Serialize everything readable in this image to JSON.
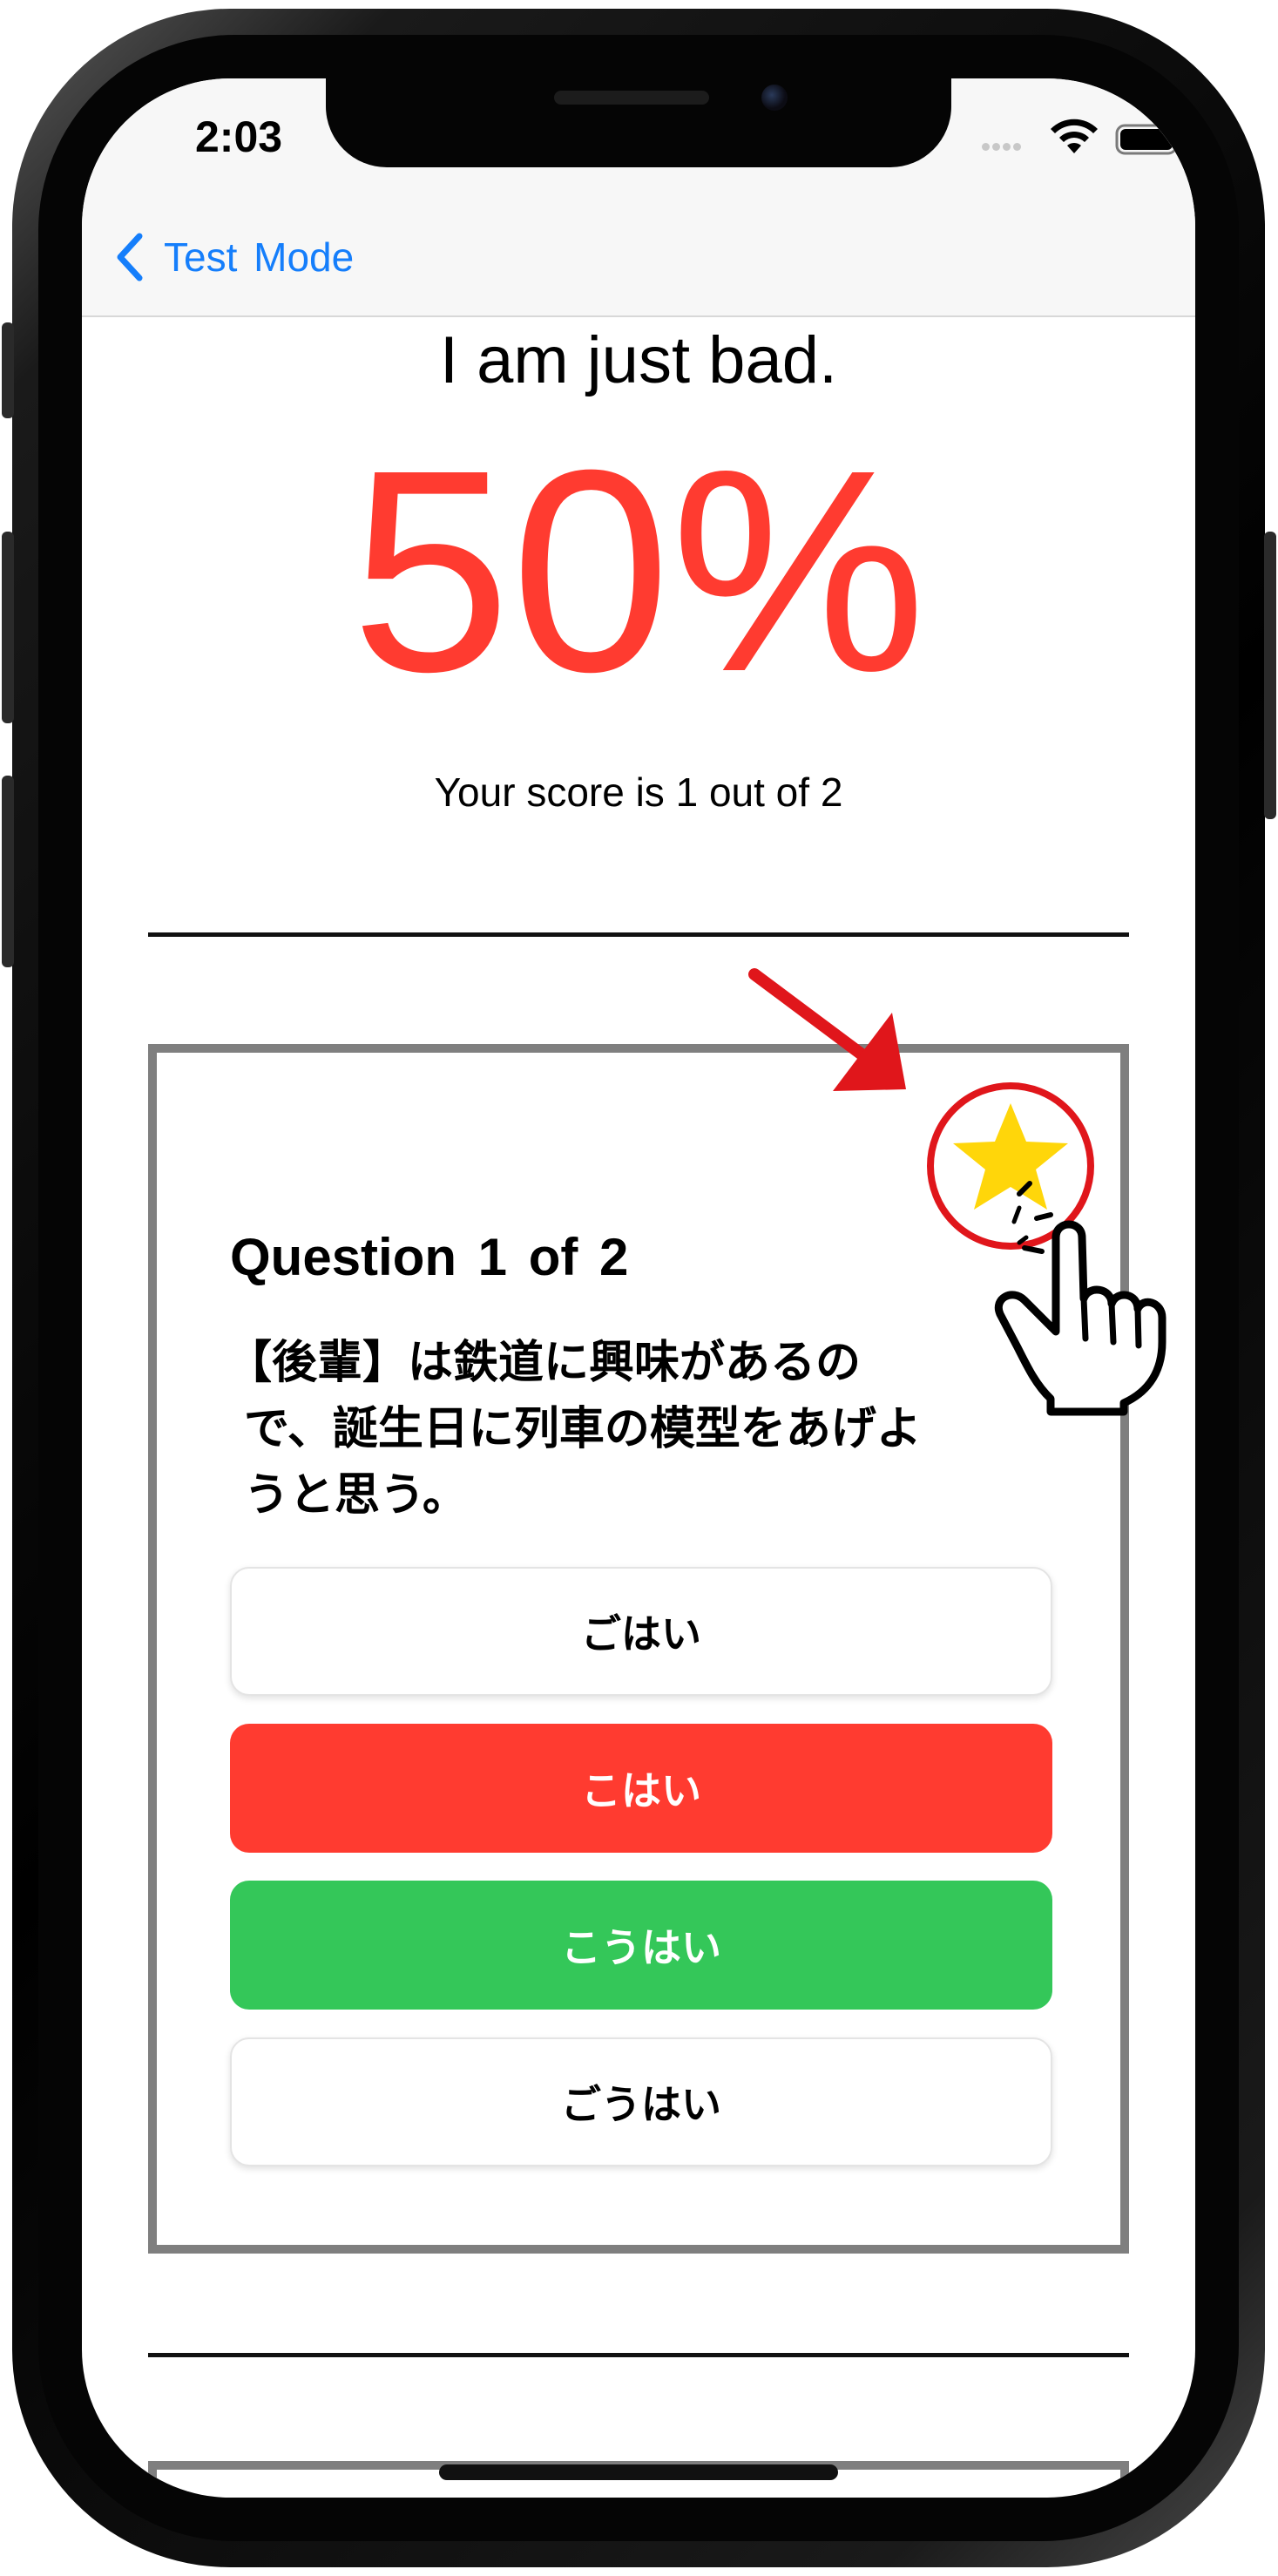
{
  "status_bar": {
    "time": "2:03"
  },
  "nav": {
    "back_label": "Test Mode"
  },
  "result": {
    "verdict": "I am just bad.",
    "percent": "50%",
    "score_text": "Your score is 1 out of 2"
  },
  "question": {
    "title": "Question 1 of 2",
    "line1": "【後輩】は鉄道に興味があるの",
    "line2": "で、誕生日に列車の模型をあげよ",
    "line3": "うと思う。",
    "options": [
      {
        "label": "ごはい",
        "state": "neutral"
      },
      {
        "label": "こはい",
        "state": "wrong"
      },
      {
        "label": "こうはい",
        "state": "correct"
      },
      {
        "label": "ごうはい",
        "state": "neutral"
      }
    ]
  },
  "colors": {
    "accent_blue": "#157efb",
    "score_red": "#ff3b30",
    "correct_green": "#34c759",
    "card_border": "#7f7f7f",
    "star_yellow": "#ffd60a",
    "annotation_red": "#e0161b"
  },
  "icons": {
    "back": "chevron-left-icon",
    "wifi": "wifi-icon",
    "battery": "battery-icon",
    "favorite": "star-icon",
    "tap": "tap-hand-icon",
    "pointer": "arrow-icon"
  }
}
